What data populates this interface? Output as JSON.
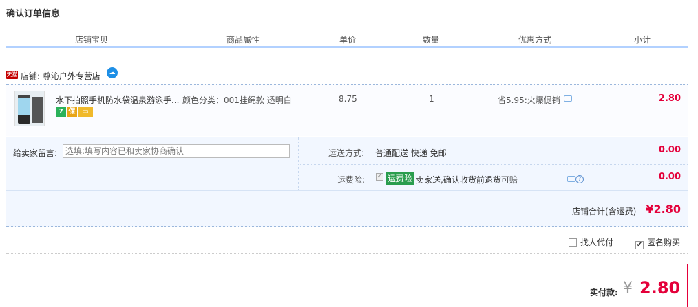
{
  "page_title": "确认订单信息",
  "columns": [
    "店铺宝贝",
    "商品属性",
    "单价",
    "数量",
    "优惠方式",
    "小计"
  ],
  "shop": {
    "badge": "天猫",
    "label": "店铺: 尊沁户外专营店",
    "chat_icon": "wangwang-icon"
  },
  "item": {
    "title": "水下拍照手机防水袋温泉游泳手...",
    "attr": "颜色分类：001挂绳款 透明白",
    "service_icons": [
      "7",
      "保"
    ],
    "unit_price": "8.75",
    "quantity": "1",
    "promo": "省5.95:火爆促销",
    "subtotal": "2.80"
  },
  "memo": {
    "label": "给卖家留言:",
    "placeholder": "选填:填写内容已和卖家协商确认"
  },
  "shipping": {
    "label": "运送方式:",
    "value": "普通配送 快递 免邮",
    "price": "0.00"
  },
  "insurance": {
    "label": "运费险:",
    "tag": "运费险",
    "desc": "卖家送,确认收货前退货可赔",
    "price": "0.00",
    "checked": true
  },
  "store_total": {
    "label": "店铺合计(含运费)",
    "value": "¥2.80"
  },
  "options": {
    "proxy_pay": "找人代付",
    "anonymous": "匿名购买",
    "proxy_checked": false,
    "anonymous_checked": true
  },
  "payment": {
    "label": "实付款:",
    "currency": "¥",
    "amount": "2.80"
  },
  "colors": {
    "accent": "#e4003a",
    "header_rule": "#b2d1ff",
    "tag_green": "#2a9d4e"
  }
}
